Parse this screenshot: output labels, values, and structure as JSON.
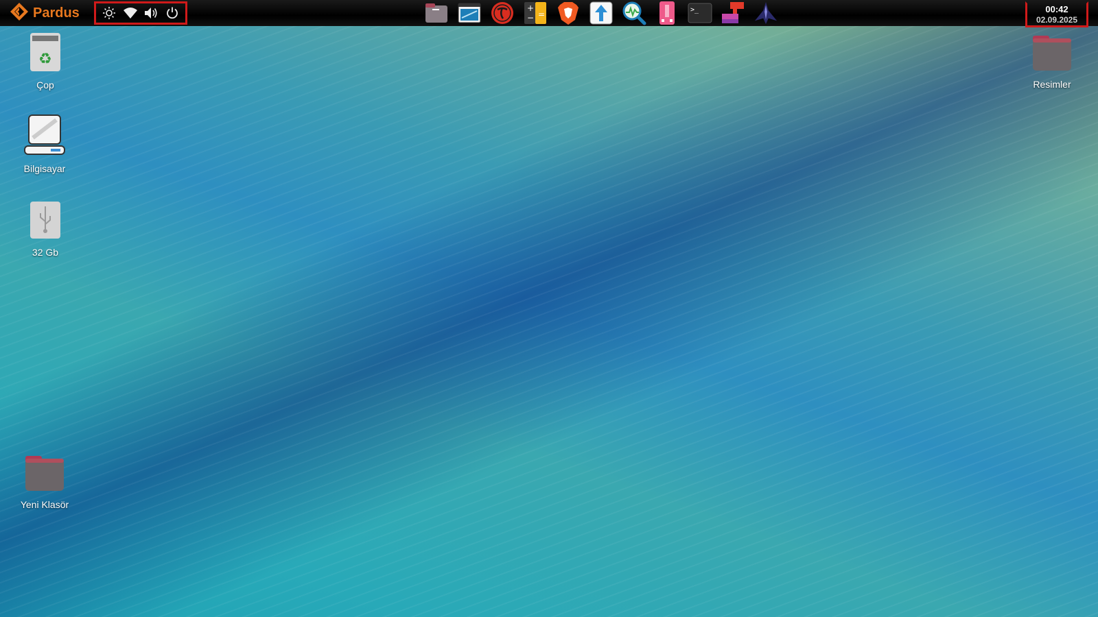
{
  "topbar": {
    "brand": "Pardus",
    "tray": [
      {
        "name": "brightness-icon"
      },
      {
        "name": "wifi-icon"
      },
      {
        "name": "volume-icon"
      },
      {
        "name": "power-icon"
      }
    ],
    "dock": [
      "file-manager-icon",
      "screenshot-icon",
      "pardus-app-icon",
      "calculator-icon",
      "brave-browser-icon",
      "software-update-icon",
      "system-monitor-icon",
      "usb-writer-icon",
      "terminal-icon",
      "app-installer-icon",
      "inkscape-icon"
    ],
    "clock": {
      "time": "00:42",
      "date": "02.09.2025"
    }
  },
  "desktop": {
    "icons": {
      "trash": "Çop",
      "computer": "Bilgisayar",
      "usb": "32 Gb",
      "new_folder": "Yeni Klasör",
      "pictures": "Resimler"
    }
  },
  "colors": {
    "brand": "#e8781e",
    "highlight": "#d01a1a",
    "folder": "#6b6568"
  }
}
